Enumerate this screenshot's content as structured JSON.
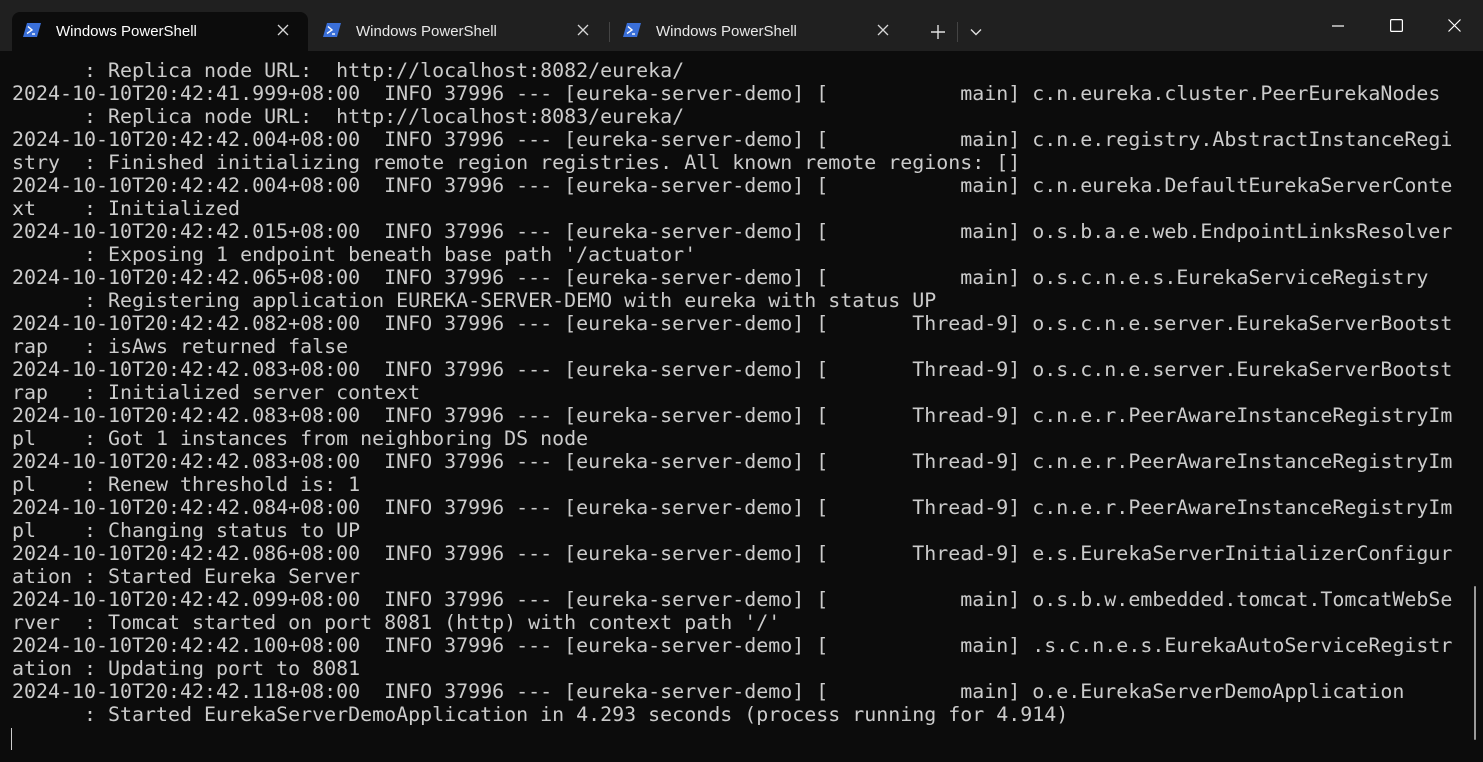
{
  "window": {
    "tabs": [
      {
        "label": "Windows PowerShell",
        "icon": "powershell-icon",
        "active": true
      },
      {
        "label": "Windows PowerShell",
        "icon": "powershell-icon",
        "active": false
      },
      {
        "label": "Windows PowerShell",
        "icon": "powershell-icon",
        "active": false
      }
    ],
    "controls": [
      "new-tab-icon",
      "chevron-down-icon",
      "minimize-icon",
      "maximize-icon",
      "close-icon"
    ],
    "accent_color": "#3a6fd8",
    "background_color": "#0c0c0c",
    "text_color": "#cccccc"
  },
  "terminal": {
    "lines": [
      "      : Replica node URL:  http://localhost:8082/eureka/",
      "2024-10-10T20:42:41.999+08:00  INFO 37996 --- [eureka-server-demo] [           main] c.n.eureka.cluster.PeerEurekaNodes",
      "      : Replica node URL:  http://localhost:8083/eureka/",
      "2024-10-10T20:42:42.004+08:00  INFO 37996 --- [eureka-server-demo] [           main] c.n.e.registry.AbstractInstanceRegi",
      "stry  : Finished initializing remote region registries. All known remote regions: []",
      "2024-10-10T20:42:42.004+08:00  INFO 37996 --- [eureka-server-demo] [           main] c.n.eureka.DefaultEurekaServerConte",
      "xt    : Initialized",
      "2024-10-10T20:42:42.015+08:00  INFO 37996 --- [eureka-server-demo] [           main] o.s.b.a.e.web.EndpointLinksResolver",
      "      : Exposing 1 endpoint beneath base path '/actuator'",
      "2024-10-10T20:42:42.065+08:00  INFO 37996 --- [eureka-server-demo] [           main] o.s.c.n.e.s.EurekaServiceRegistry",
      "      : Registering application EUREKA-SERVER-DEMO with eureka with status UP",
      "2024-10-10T20:42:42.082+08:00  INFO 37996 --- [eureka-server-demo] [       Thread-9] o.s.c.n.e.server.EurekaServerBootst",
      "rap   : isAws returned false",
      "2024-10-10T20:42:42.083+08:00  INFO 37996 --- [eureka-server-demo] [       Thread-9] o.s.c.n.e.server.EurekaServerBootst",
      "rap   : Initialized server context",
      "2024-10-10T20:42:42.083+08:00  INFO 37996 --- [eureka-server-demo] [       Thread-9] c.n.e.r.PeerAwareInstanceRegistryIm",
      "pl    : Got 1 instances from neighboring DS node",
      "2024-10-10T20:42:42.083+08:00  INFO 37996 --- [eureka-server-demo] [       Thread-9] c.n.e.r.PeerAwareInstanceRegistryIm",
      "pl    : Renew threshold is: 1",
      "2024-10-10T20:42:42.084+08:00  INFO 37996 --- [eureka-server-demo] [       Thread-9] c.n.e.r.PeerAwareInstanceRegistryIm",
      "pl    : Changing status to UP",
      "2024-10-10T20:42:42.086+08:00  INFO 37996 --- [eureka-server-demo] [       Thread-9] e.s.EurekaServerInitializerConfigur",
      "ation : Started Eureka Server",
      "2024-10-10T20:42:42.099+08:00  INFO 37996 --- [eureka-server-demo] [           main] o.s.b.w.embedded.tomcat.TomcatWebSe",
      "rver  : Tomcat started on port 8081 (http) with context path '/'",
      "2024-10-10T20:42:42.100+08:00  INFO 37996 --- [eureka-server-demo] [           main] .s.c.n.e.s.EurekaAutoServiceRegistr",
      "ation : Updating port to 8081",
      "2024-10-10T20:42:42.118+08:00  INFO 37996 --- [eureka-server-demo] [           main] o.e.EurekaServerDemoApplication",
      "      : Started EurekaServerDemoApplication in 4.293 seconds (process running for 4.914)"
    ]
  }
}
